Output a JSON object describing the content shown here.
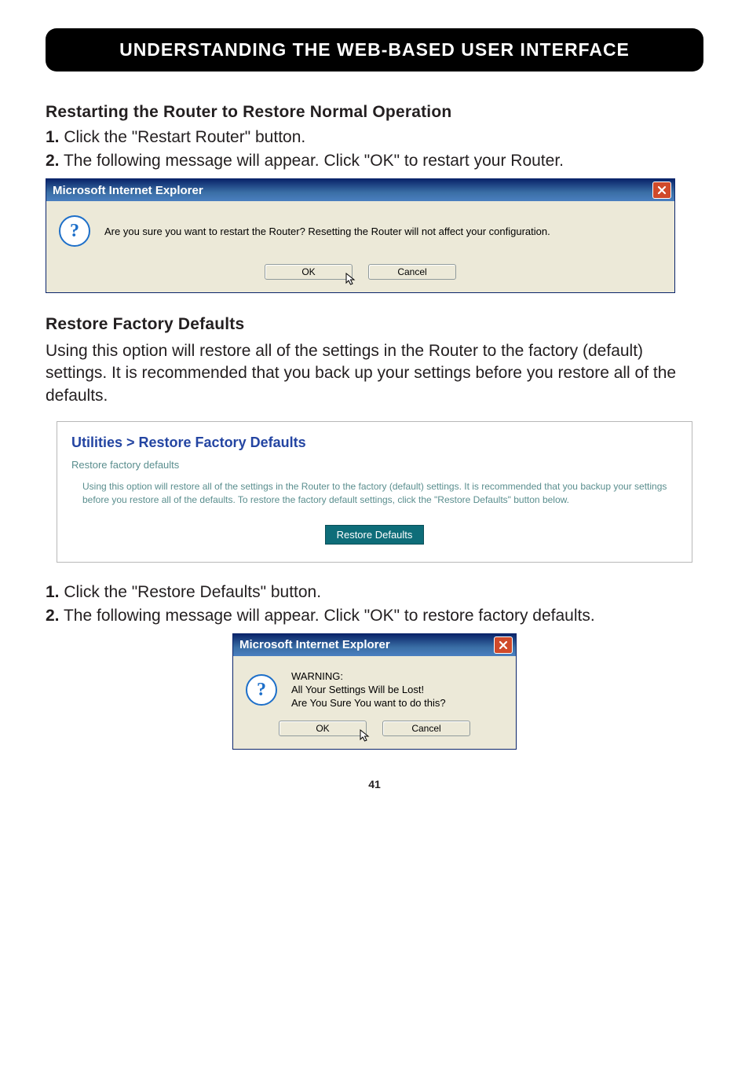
{
  "header": {
    "title": "UNDERSTANDING THE WEB-BASED USER INTERFACE"
  },
  "section1": {
    "heading": "Restarting the Router to Restore Normal Operation",
    "step1_num": "1.",
    "step1_text": " Click the \"Restart Router\" button.",
    "step2_num": "2.",
    "step2_text": " The following message will appear. Click \"OK\" to restart your Router."
  },
  "dialog1": {
    "title": "Microsoft Internet Explorer",
    "message": "Are you sure you want to restart the Router? Resetting the Router will not affect your configuration.",
    "ok_label": "OK",
    "cancel_label": "Cancel"
  },
  "section2": {
    "heading": "Restore Factory Defaults",
    "body": "Using this option will restore all of the settings in the Router to the factory (default) settings. It is recommended that you back up your settings before you restore all of the defaults."
  },
  "panel": {
    "title": "Utilities > Restore Factory Defaults",
    "subtitle": "Restore factory defaults",
    "body": "Using this option will restore all of the settings in the Router to the factory (default) settings. It is recommended that you backup your settings before you restore all of the defaults. To restore the factory default settings, click the \"Restore Defaults\" button below.",
    "button_label": "Restore Defaults"
  },
  "section3": {
    "step1_num": "1.",
    "step1_text": " Click the \"Restore Defaults\" button.",
    "step2_num": "2.",
    "step2_text": " The following message will appear. Click \"OK\" to restore factory defaults."
  },
  "dialog2": {
    "title": "Microsoft Internet Explorer",
    "line1": "WARNING:",
    "line2": "All Your Settings Will be Lost!",
    "line3": "Are You Sure You want to do this?",
    "ok_label": "OK",
    "cancel_label": "Cancel"
  },
  "page_number": "41"
}
